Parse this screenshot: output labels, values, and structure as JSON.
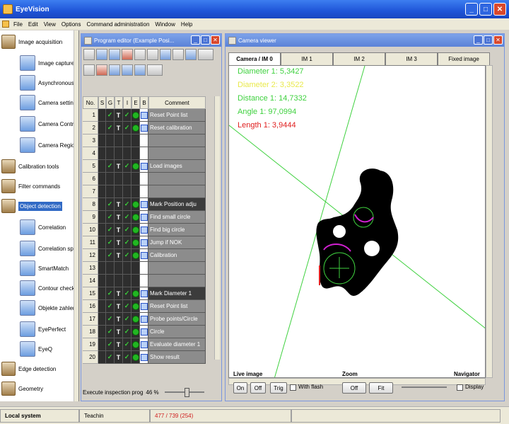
{
  "window": {
    "title": "EyeVision"
  },
  "menu": [
    "File",
    "Edit",
    "View",
    "Options",
    "Command administration",
    "Window",
    "Help"
  ],
  "sidebar": {
    "items": [
      {
        "label": "Image acquisition",
        "kind": "cat"
      },
      {
        "label": "Image capture",
        "kind": "sub"
      },
      {
        "label": "Asynchronous",
        "kind": "sub"
      },
      {
        "label": "Camera setting",
        "kind": "sub"
      },
      {
        "label": "Camera Control",
        "kind": "sub"
      },
      {
        "label": "Camera Region",
        "kind": "sub"
      },
      {
        "label": "Calibration tools",
        "kind": "cat"
      },
      {
        "label": "Filter commands",
        "kind": "cat"
      },
      {
        "label": "Object detection",
        "kind": "cat",
        "selected": true
      },
      {
        "label": "Correlation",
        "kind": "sub"
      },
      {
        "label": "Correlation spo",
        "kind": "sub"
      },
      {
        "label": "SmartMatch",
        "kind": "sub"
      },
      {
        "label": "Contour check",
        "kind": "sub"
      },
      {
        "label": "Objekte zahlen",
        "kind": "sub"
      },
      {
        "label": "EyePerfect",
        "kind": "sub"
      },
      {
        "label": "EyeQ",
        "kind": "sub"
      },
      {
        "label": "Edge detection",
        "kind": "cat"
      },
      {
        "label": "Geometry",
        "kind": "cat"
      }
    ]
  },
  "program_editor": {
    "title": "Program editor (Example Posi...",
    "columns": [
      "No.",
      "S",
      "G",
      "T",
      "I",
      "E",
      "B",
      "Comment"
    ],
    "rows": [
      {
        "no": "1",
        "active": true,
        "comment": "Reset Point list"
      },
      {
        "no": "2",
        "active": true,
        "comment": "Reset calibration"
      },
      {
        "no": "3",
        "active": false,
        "comment": ""
      },
      {
        "no": "4",
        "active": false,
        "comment": ""
      },
      {
        "no": "5",
        "active": true,
        "comment": "Load images"
      },
      {
        "no": "6",
        "active": false,
        "comment": ""
      },
      {
        "no": "7",
        "active": false,
        "comment": ""
      },
      {
        "no": "8",
        "active": true,
        "comment": "Mark Position adju",
        "selected": true
      },
      {
        "no": "9",
        "active": true,
        "comment": "Find small circle"
      },
      {
        "no": "10",
        "active": true,
        "comment": "Find big circle"
      },
      {
        "no": "11",
        "active": true,
        "comment": "Jump if NOK"
      },
      {
        "no": "12",
        "active": true,
        "comment": "Calibration"
      },
      {
        "no": "13",
        "active": false,
        "comment": ""
      },
      {
        "no": "14",
        "active": false,
        "comment": ""
      },
      {
        "no": "15",
        "active": true,
        "comment": "Mark Diameter 1",
        "selected": true
      },
      {
        "no": "16",
        "active": true,
        "comment": "Reset Point list"
      },
      {
        "no": "17",
        "active": true,
        "comment": "Probe points/Circle"
      },
      {
        "no": "18",
        "active": true,
        "comment": "Circle"
      },
      {
        "no": "19",
        "active": true,
        "comment": "Evaluate diameter 1"
      },
      {
        "no": "20",
        "active": true,
        "comment": "Show result"
      }
    ],
    "exec_label": "Execute inspection prog",
    "exec_percent": "46 %"
  },
  "camera_viewer": {
    "title": "Camera viewer",
    "tabs": [
      "Camera / IM 0",
      "IM 1",
      "IM 2",
      "IM 3",
      "Fixed image"
    ],
    "measurements": [
      {
        "text": "Diameter 1: 5,3427",
        "color": "#3fd13f"
      },
      {
        "text": "Diameter 2: 3,3522",
        "color": "#e9e94a"
      },
      {
        "text": "Distance 1: 14,7332",
        "color": "#3fd13f"
      },
      {
        "text": "Angle 1: 97,0994",
        "color": "#3fd13f"
      },
      {
        "text": "Length 1: 3,9444",
        "color": "#e02020"
      }
    ]
  },
  "controls": {
    "live_image": {
      "label": "Live image",
      "on": "On",
      "off": "Off",
      "trig": "Trig",
      "with_flash": "With flash"
    },
    "zoom": {
      "label": "Zoom",
      "off": "Off",
      "fit": "Fit"
    },
    "navigator": {
      "label": "Navigator",
      "display": "Display"
    }
  },
  "status": {
    "system": "Local system",
    "mode": "Teachin",
    "counter": "477 / 739 (254)"
  },
  "colors": {
    "accent": "#316ac5",
    "titlebar": "#1f55d8",
    "ok": "#22b622"
  }
}
